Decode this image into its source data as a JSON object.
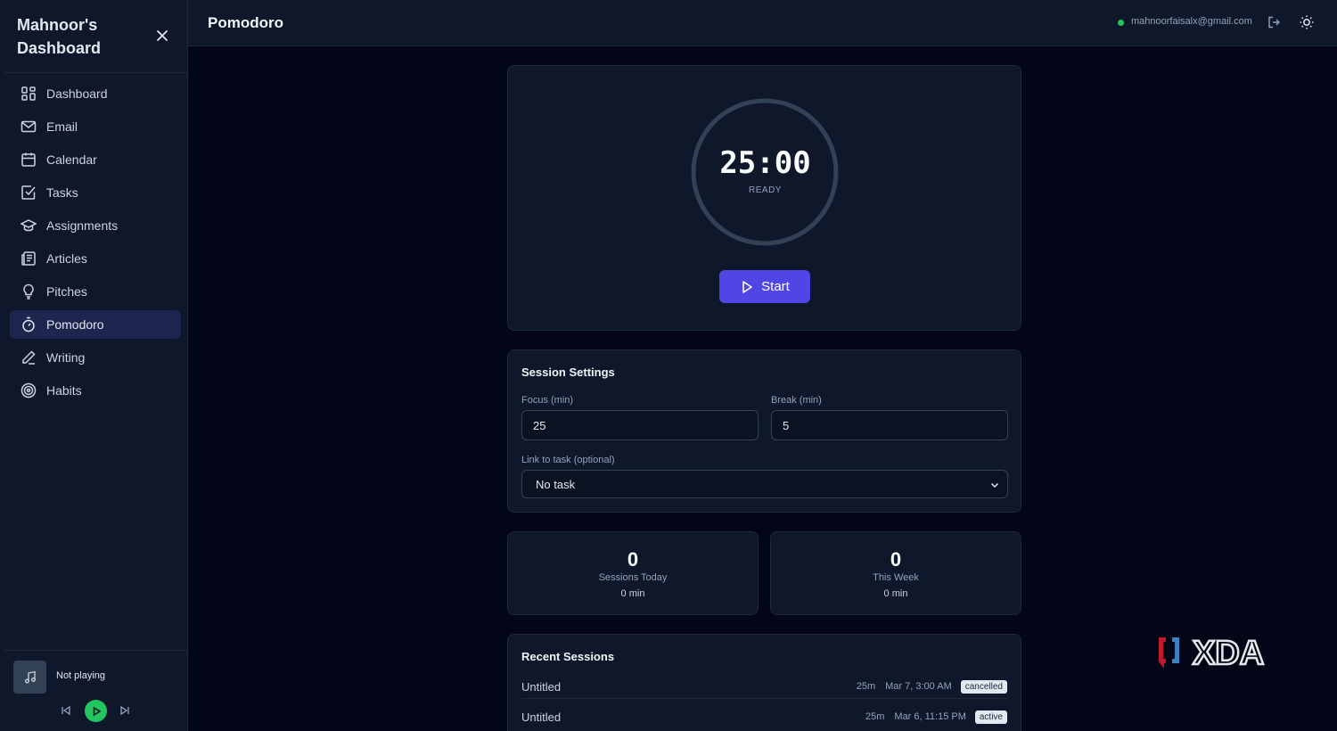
{
  "sidebar": {
    "brand": "Mahnoor's Dashboard",
    "items": [
      {
        "label": "Dashboard",
        "icon": "dashboard-icon"
      },
      {
        "label": "Email",
        "icon": "mail-icon"
      },
      {
        "label": "Calendar",
        "icon": "calendar-icon"
      },
      {
        "label": "Tasks",
        "icon": "check-square-icon"
      },
      {
        "label": "Assignments",
        "icon": "graduation-cap-icon"
      },
      {
        "label": "Articles",
        "icon": "newspaper-icon"
      },
      {
        "label": "Pitches",
        "icon": "lightbulb-icon"
      },
      {
        "label": "Pomodoro",
        "icon": "timer-icon",
        "active": true
      },
      {
        "label": "Writing",
        "icon": "pen-icon"
      },
      {
        "label": "Habits",
        "icon": "target-icon"
      }
    ],
    "player": {
      "status": "Not playing"
    }
  },
  "header": {
    "title": "Pomodoro",
    "email": "mahnoorfaisalx@gmail.com"
  },
  "timer": {
    "time": "25:00",
    "state": "READY",
    "start_label": "Start"
  },
  "settings": {
    "title": "Session Settings",
    "focus_label": "Focus (min)",
    "focus_value": "25",
    "break_label": "Break (min)",
    "break_value": "5",
    "task_label": "Link to task (optional)",
    "task_value": "No task"
  },
  "stats": {
    "today": {
      "count": "0",
      "label": "Sessions Today",
      "minutes": "0 min"
    },
    "week": {
      "count": "0",
      "label": "This Week",
      "minutes": "0 min"
    }
  },
  "recent": {
    "title": "Recent Sessions",
    "sessions": [
      {
        "name": "Untitled",
        "duration": "25m",
        "date": "Mar 7, 3:00 AM",
        "status": "cancelled"
      },
      {
        "name": "Untitled",
        "duration": "25m",
        "date": "Mar 6, 11:15 PM",
        "status": "active"
      }
    ]
  },
  "watermark": {
    "text": "XDA"
  },
  "colors": {
    "background": "#020617",
    "panel": "#0f172a",
    "accent": "#4f46e5",
    "active_nav": "#1e2650",
    "online": "#22c55e"
  }
}
